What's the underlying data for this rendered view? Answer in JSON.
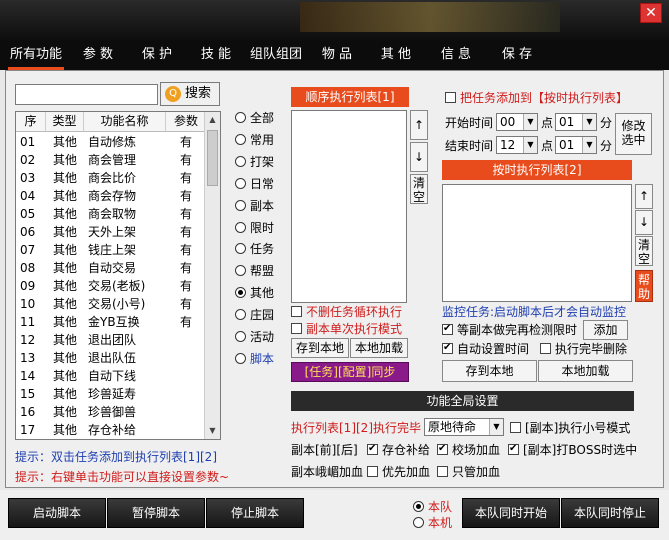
{
  "tabs": [
    "所有功能",
    "参 数",
    "保 护",
    "技 能",
    "组队组团",
    "物 品",
    "其 他",
    "信 息",
    "保 存"
  ],
  "search_button": "搜索",
  "table": {
    "headers": [
      "序",
      "类型",
      "功能名称",
      "参数"
    ],
    "rows": [
      [
        "01",
        "其他",
        "自动修炼",
        "有"
      ],
      [
        "02",
        "其他",
        "商会管理",
        "有"
      ],
      [
        "03",
        "其他",
        "商会比价",
        "有"
      ],
      [
        "04",
        "其他",
        "商会存物",
        "有"
      ],
      [
        "05",
        "其他",
        "商会取物",
        "有"
      ],
      [
        "06",
        "其他",
        "天外上架",
        "有"
      ],
      [
        "07",
        "其他",
        "钱庄上架",
        "有"
      ],
      [
        "08",
        "其他",
        "自动交易",
        "有"
      ],
      [
        "09",
        "其他",
        "交易(老板)",
        "有"
      ],
      [
        "10",
        "其他",
        "交易(小号)",
        "有"
      ],
      [
        "11",
        "其他",
        "金YB互换",
        "有"
      ],
      [
        "12",
        "其他",
        "退出团队",
        ""
      ],
      [
        "13",
        "其他",
        "退出队伍",
        ""
      ],
      [
        "14",
        "其他",
        "自动下线",
        ""
      ],
      [
        "15",
        "其他",
        "珍兽延寿",
        ""
      ],
      [
        "16",
        "其他",
        "珍兽御兽",
        ""
      ],
      [
        "17",
        "其他",
        "存仓补给",
        ""
      ]
    ]
  },
  "hints": [
    "提示：双击任务添加到执行列表[1][2]",
    "提示：右键单击功能可以直接设置参数~"
  ],
  "filters": [
    "全部",
    "常用",
    "打架",
    "日常",
    "副本",
    "限时",
    "任务",
    "帮盟",
    "其他",
    "庄园",
    "活动",
    "脚本"
  ],
  "selected_filter": "其他",
  "seq_list": {
    "title": "顺序执行列表[1]",
    "clear": "清空",
    "no_delete_loop": "不删任务循环执行",
    "dungeon_single": "副本单次执行模式",
    "save_local": "存到本地",
    "load_local": "本地加载",
    "sync": "[任务][配置]同步"
  },
  "timed": {
    "add_to_timed": "把任务添加到【按时执行列表】",
    "start_time": "开始时间",
    "end_time": "结束时间",
    "point": "点",
    "minute": "分",
    "start_hour": "00",
    "start_min": "01",
    "end_hour": "12",
    "end_min": "01",
    "modify_selected": "修改选中",
    "list_title": "按时执行列表[2]",
    "clear": "清空",
    "help": "帮助",
    "monitor_hint": "监控任务:启动脚本后才会自动监控",
    "wait_dungeon": "等副本做完再检测限时",
    "add": "添加",
    "auto_time": "自动设置时间",
    "delete_after": "执行完毕删除",
    "save_local": "存到本地",
    "load_local": "本地加载"
  },
  "global": {
    "title": "功能全局设置",
    "list_done_label": "执行列表[1][2]执行完毕",
    "list_done_value": "原地待命",
    "small_mode": "[副本]执行小号模式",
    "dungeon_front_back": "副本[前][后]",
    "store_supply": "存仓补给",
    "school_add_blood": "校场加血",
    "boss_selected": "[副本]打BOSS时选中",
    "dungeon_emei": "副本峨嵋加血",
    "priority_blood": "优先加血",
    "only_blood": "只管加血"
  },
  "bottom": {
    "start": "启动脚本",
    "pause": "暂停脚本",
    "stop": "停止脚本",
    "team": "本队",
    "local": "本机",
    "team_start": "本队同时开始",
    "team_stop": "本队同时停止"
  }
}
